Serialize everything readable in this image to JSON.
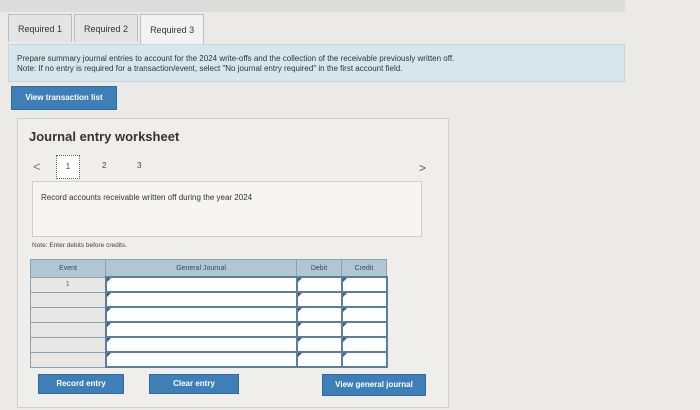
{
  "tabs": [
    {
      "label": "Required 1"
    },
    {
      "label": "Required 2"
    },
    {
      "label": "Required 3"
    }
  ],
  "instructions": {
    "line1": "Prepare summary journal entries to account for the 2024 write-offs and the collection of the receivable previously written off.",
    "line2": "Note: If no entry is required for a transaction/event, select \"No journal entry required\" in the first account field."
  },
  "view_transaction_list": "View transaction list",
  "worksheet": {
    "title": "Journal entry worksheet",
    "pages": [
      "1",
      "2",
      "3"
    ],
    "prev_arrow": "<",
    "next_arrow": ">",
    "description": "Record accounts receivable written off during the year 2024",
    "note": "Note: Enter debits before credits."
  },
  "table": {
    "headers": {
      "event": "Event",
      "account": "General Journal",
      "debit": "Debit",
      "credit": "Credit"
    },
    "rows": [
      {
        "event": "1"
      },
      {
        "event": ""
      },
      {
        "event": ""
      },
      {
        "event": ""
      },
      {
        "event": ""
      },
      {
        "event": ""
      }
    ]
  },
  "buttons": {
    "record": "Record entry",
    "clear": "Clear entry",
    "general": "View general journal"
  }
}
